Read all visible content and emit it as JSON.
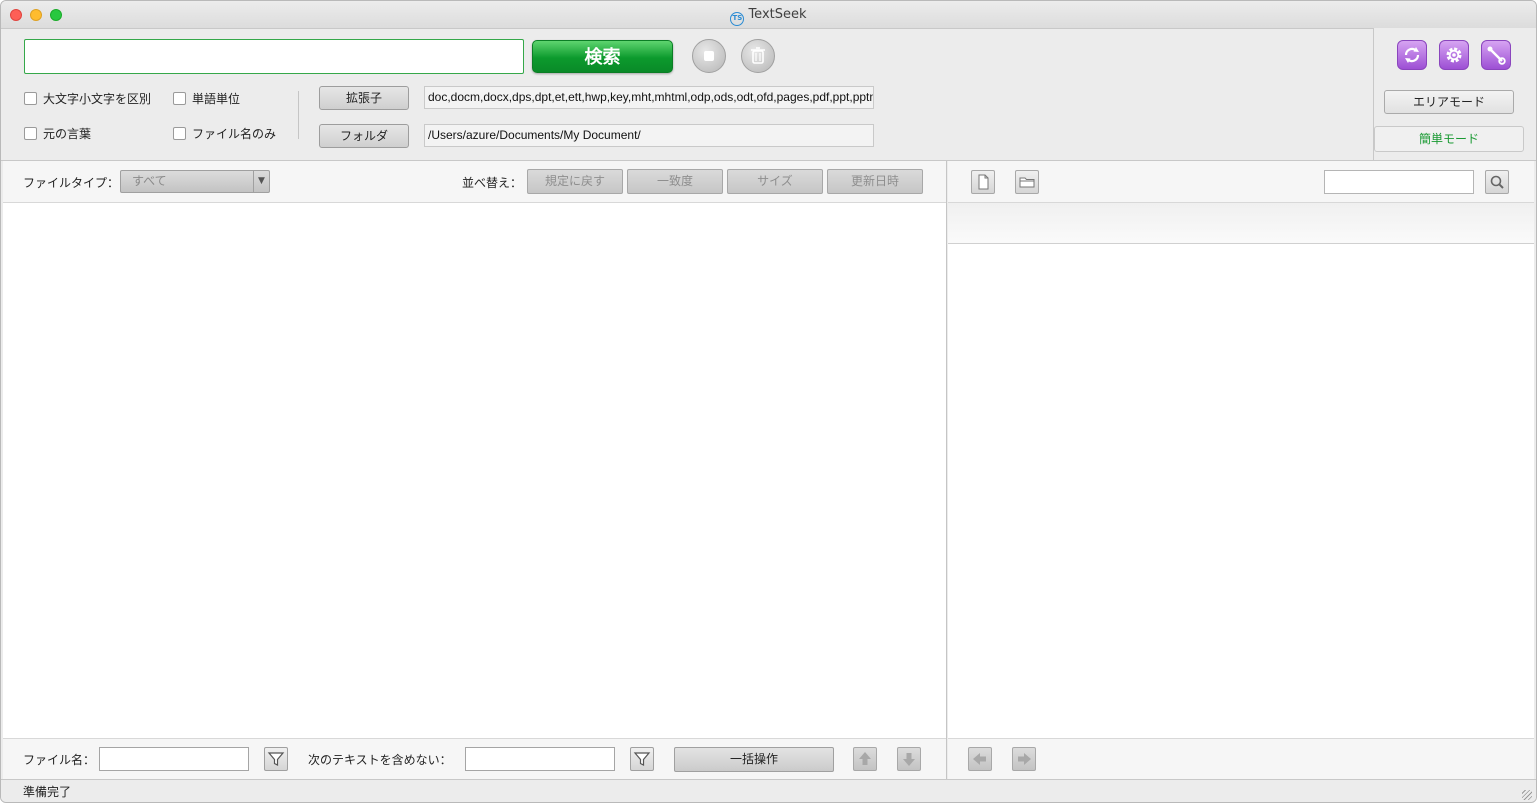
{
  "window": {
    "title": "TextSeek",
    "app_icon_letters": "TS"
  },
  "search": {
    "value": "",
    "button_label": "検索"
  },
  "options": {
    "case_sensitive": {
      "label": "大文字小文字を区別",
      "checked": false
    },
    "whole_word": {
      "label": "単語単位",
      "checked": false
    },
    "original_language": {
      "label": "元の言葉",
      "checked": false
    },
    "filename_only": {
      "label": "ファイル名のみ",
      "checked": false
    }
  },
  "extensions": {
    "button_label": "拡張子",
    "value": "doc,docm,docx,dps,dpt,et,ett,hwp,key,mht,mhtml,odp,ods,odt,ofd,pages,pdf,ppt,pptm"
  },
  "folder": {
    "button_label": "フォルダ",
    "value": "/Users/azure/Documents/My Document/"
  },
  "mode": {
    "area_label": "エリアモード",
    "easy_label": "簡単モード",
    "accent_color": "#1a9a33"
  },
  "results": {
    "file_type_label": "ファイルタイプ：",
    "file_type_value": "すべて",
    "sort_label": "並べ替え：",
    "sort_buttons": [
      "規定に戻す",
      "一致度",
      "サイズ",
      "更新日時"
    ]
  },
  "footer": {
    "filename_label": "ファイル名：",
    "filename_value": "",
    "exclude_label": "次のテキストを含めない：",
    "exclude_value": "",
    "bulk_label": "一括操作"
  },
  "status": {
    "text": "準備完了"
  },
  "icons": {
    "refresh": "refresh-icon",
    "settings": "gear-icon",
    "tools": "tools-icon"
  }
}
